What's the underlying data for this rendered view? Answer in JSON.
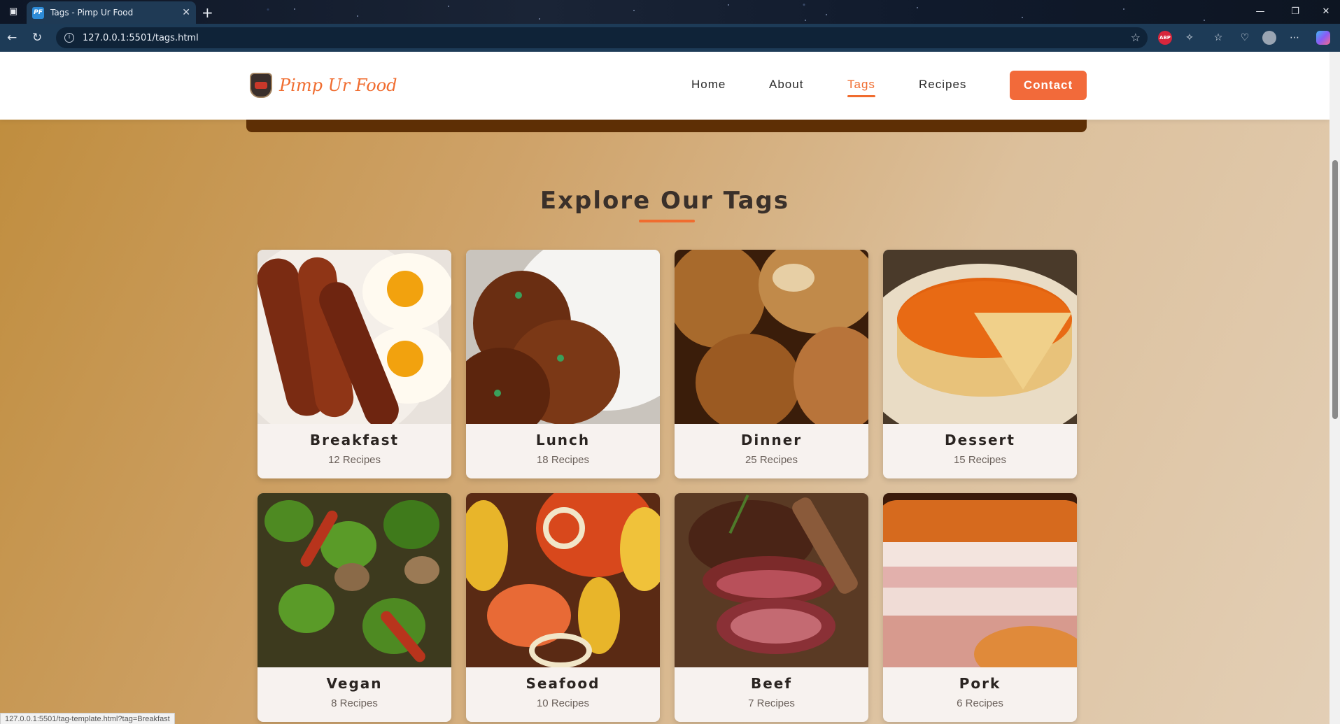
{
  "browser": {
    "tab_title": "Tags - Pimp Ur Food",
    "favicon_text": "PF",
    "url": "127.0.0.1:5501/tags.html",
    "status_url": "127.0.0.1:5501/tag-template.html?tag=Breakfast"
  },
  "site": {
    "logo_text": "Pimp Ur Food",
    "nav": [
      {
        "label": "Home"
      },
      {
        "label": "About"
      },
      {
        "label": "Tags",
        "active": true
      },
      {
        "label": "Recipes"
      }
    ],
    "contact_label": "Contact"
  },
  "section": {
    "title": "Explore Our Tags"
  },
  "tags": [
    {
      "name": "Breakfast",
      "count": "12 Recipes",
      "image": "breakfast-image"
    },
    {
      "name": "Lunch",
      "count": "18 Recipes",
      "image": "lunch-image"
    },
    {
      "name": "Dinner",
      "count": "25 Recipes",
      "image": "dinner-image"
    },
    {
      "name": "Dessert",
      "count": "15 Recipes",
      "image": "dessert-image"
    },
    {
      "name": "Vegan",
      "count": "8 Recipes",
      "image": "vegan-image"
    },
    {
      "name": "Seafood",
      "count": "10 Recipes",
      "image": "seafood-image"
    },
    {
      "name": "Beef",
      "count": "7 Recipes",
      "image": "beef-image"
    },
    {
      "name": "Pork",
      "count": "6 Recipes",
      "image": "pork-image"
    }
  ],
  "colors": {
    "accent": "#f06c2f",
    "title": "#3a302a"
  }
}
